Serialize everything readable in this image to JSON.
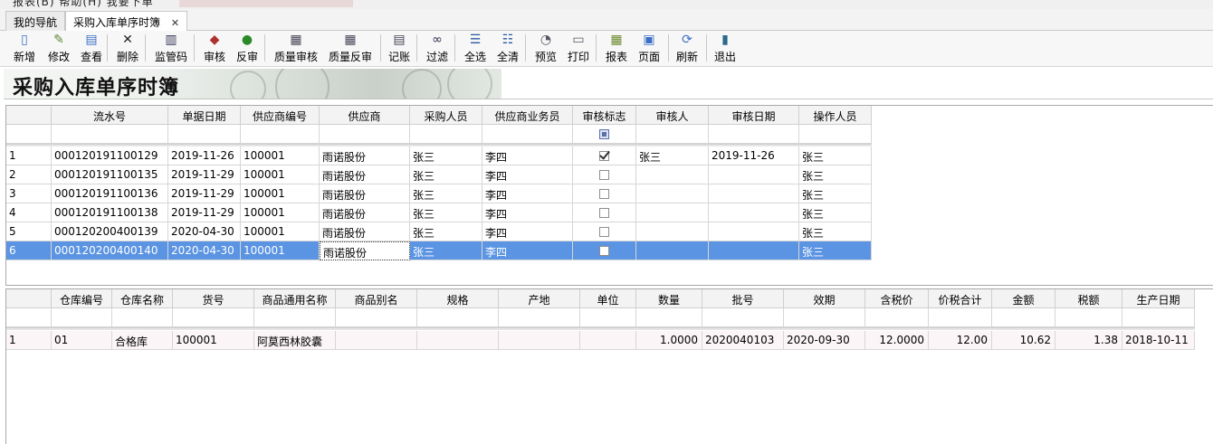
{
  "menu_strip": "报表(B)   帮助(H)   我要下单",
  "tabs": [
    {
      "label": "我的导航",
      "active": false
    },
    {
      "label": "采购入库单序时簿",
      "active": true,
      "close": "✕"
    }
  ],
  "toolbar": [
    {
      "label": "新增",
      "icon": "new-document-icon"
    },
    {
      "label": "修改",
      "icon": "edit-icon"
    },
    {
      "label": "查看",
      "icon": "view-icon"
    },
    {
      "label": "删除",
      "icon": "delete-x-icon"
    },
    {
      "label": "监管码",
      "icon": "barcode-icon"
    },
    {
      "label": "审核",
      "icon": "audit-icon"
    },
    {
      "label": "反审",
      "icon": "reverse-audit-icon"
    },
    {
      "label": "质量审核",
      "icon": "quality-audit-icon"
    },
    {
      "label": "质量反审",
      "icon": "quality-reverse-icon"
    },
    {
      "label": "记账",
      "icon": "ledger-icon"
    },
    {
      "label": "过滤",
      "icon": "binoculars-icon"
    },
    {
      "label": "全选",
      "icon": "select-all-icon"
    },
    {
      "label": "全清",
      "icon": "clear-all-icon"
    },
    {
      "label": "预览",
      "icon": "preview-icon"
    },
    {
      "label": "打印",
      "icon": "printer-icon"
    },
    {
      "label": "报表",
      "icon": "report-icon"
    },
    {
      "label": "页面",
      "icon": "page-icon"
    },
    {
      "label": "刷新",
      "icon": "refresh-icon"
    },
    {
      "label": "退出",
      "icon": "exit-icon"
    }
  ],
  "banner_title": "采购入库单序时簿",
  "master": {
    "columns": [
      "",
      "流水号",
      "单据日期",
      "供应商编号",
      "供应商",
      "采购人员",
      "供应商业务员",
      "审核标志",
      "审核人",
      "审核日期",
      "操作人员"
    ],
    "rows": [
      {
        "no": "1",
        "serial": "000120191100129",
        "date": "2019-11-26",
        "supplier_code": "100001",
        "supplier": "雨诺股份",
        "buyer": "张三",
        "supplier_rep": "李四",
        "audited": true,
        "auditor": "张三",
        "audit_date": "2019-11-26",
        "operator": "张三"
      },
      {
        "no": "2",
        "serial": "000120191100135",
        "date": "2019-11-29",
        "supplier_code": "100001",
        "supplier": "雨诺股份",
        "buyer": "张三",
        "supplier_rep": "李四",
        "audited": false,
        "auditor": "",
        "audit_date": "",
        "operator": "张三"
      },
      {
        "no": "3",
        "serial": "000120191100136",
        "date": "2019-11-29",
        "supplier_code": "100001",
        "supplier": "雨诺股份",
        "buyer": "张三",
        "supplier_rep": "李四",
        "audited": false,
        "auditor": "",
        "audit_date": "",
        "operator": "张三"
      },
      {
        "no": "4",
        "serial": "000120191100138",
        "date": "2019-11-29",
        "supplier_code": "100001",
        "supplier": "雨诺股份",
        "buyer": "张三",
        "supplier_rep": "李四",
        "audited": false,
        "auditor": "",
        "audit_date": "",
        "operator": "张三"
      },
      {
        "no": "5",
        "serial": "000120200400139",
        "date": "2020-04-30",
        "supplier_code": "100001",
        "supplier": "雨诺股份",
        "buyer": "张三",
        "supplier_rep": "李四",
        "audited": false,
        "auditor": "",
        "audit_date": "",
        "operator": "张三"
      },
      {
        "no": "6",
        "serial": "000120200400140",
        "date": "2020-04-30",
        "supplier_code": "100001",
        "supplier": "雨诺股份",
        "buyer": "张三",
        "supplier_rep": "李四",
        "audited": false,
        "auditor": "",
        "audit_date": "",
        "operator": "张三"
      }
    ],
    "selected_row": 6
  },
  "detail": {
    "columns": [
      "",
      "仓库编号",
      "仓库名称",
      "货号",
      "商品通用名称",
      "商品别名",
      "规格",
      "产地",
      "单位",
      "数量",
      "批号",
      "效期",
      "含税价",
      "价税合计",
      "金额",
      "税额",
      "生产日期"
    ],
    "rows": [
      {
        "no": "1",
        "wh_code": "01",
        "wh_name": "合格库",
        "item_no": "100001",
        "generic_name": "阿莫西林胶囊",
        "alias": "",
        "spec": "",
        "origin": "",
        "unit": "",
        "qty": "1.0000",
        "batch": "2020040103",
        "expiry": "2020-09-30",
        "price_tax": "12.0000",
        "total_tax": "12.00",
        "amount": "10.62",
        "tax": "1.38",
        "mfg_date": "2018-10-11"
      }
    ]
  }
}
